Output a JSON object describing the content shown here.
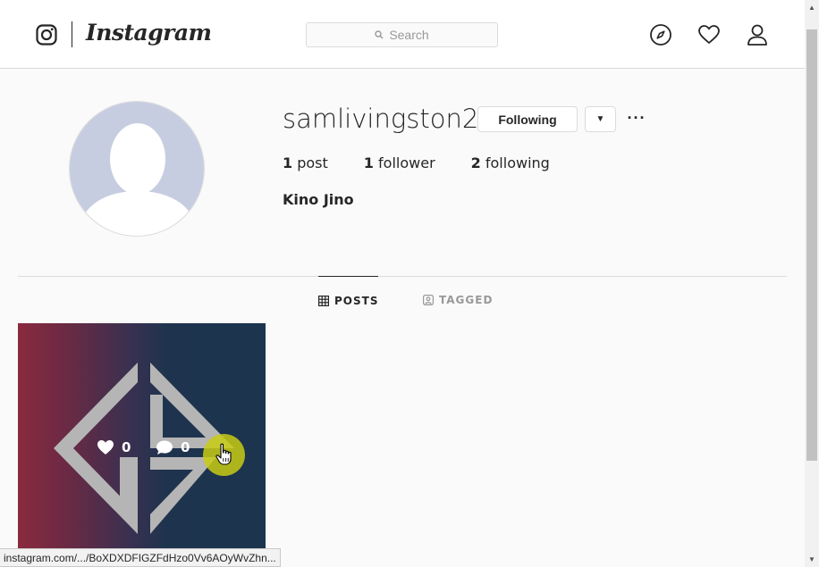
{
  "nav": {
    "wordmark": "Instagram",
    "search_placeholder": "Search",
    "icons": [
      "instagram-glyph-icon",
      "compass-icon",
      "heart-icon",
      "profile-icon"
    ]
  },
  "profile": {
    "username": "samlivingston2",
    "following_button": "Following",
    "dropdown_glyph": "▼",
    "more_glyph": "···",
    "stats": {
      "posts_count": "1",
      "posts_label": "post",
      "followers_count": "1",
      "followers_label": "follower",
      "following_count": "2",
      "following_label": "following"
    },
    "full_name": "Kino Jino"
  },
  "tabs": {
    "posts": "POSTS",
    "tagged": "TAGGED",
    "active": "POSTS"
  },
  "post": {
    "likes": "0",
    "comments": "0"
  },
  "statusbar": {
    "url": "instagram.com/.../BoXDXDFIGZFdHzo0Vv6AOyWvZhn..."
  },
  "colors": {
    "text": "#262626",
    "border": "#dbdbdb",
    "background": "#fafafa",
    "cursor_highlight": "#c8cd14"
  }
}
